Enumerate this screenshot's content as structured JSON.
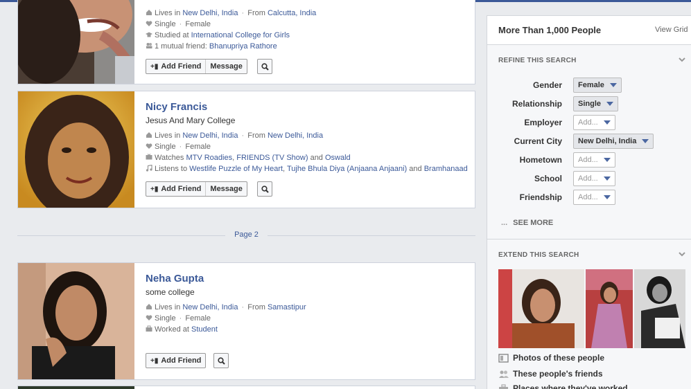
{
  "results": [
    {
      "name": "",
      "subtitle": "",
      "lines": [
        {
          "icon": "home-icon",
          "parts": [
            {
              "t": "Lives in "
            },
            {
              "t": "New Delhi, India",
              "link": true
            },
            {
              "t": " · ",
              "dot": true
            },
            {
              "t": "From "
            },
            {
              "t": "Calcutta, India",
              "link": true
            }
          ]
        },
        {
          "icon": "heart-icon",
          "parts": [
            {
              "t": "Single"
            },
            {
              "t": " · ",
              "dot": true
            },
            {
              "t": "Female"
            }
          ]
        },
        {
          "icon": "education-icon",
          "parts": [
            {
              "t": "Studied at "
            },
            {
              "t": "International College for Girls",
              "link": true
            }
          ]
        },
        {
          "icon": "mutual-friends-icon",
          "parts": [
            {
              "t": "1 mutual friend: "
            },
            {
              "t": "Bhanupriya Rathore",
              "link": true
            }
          ]
        }
      ],
      "buttons": [
        "Add Friend",
        "Message"
      ]
    },
    {
      "name": "Nicy Francis",
      "subtitle": "Jesus And Mary College",
      "lines": [
        {
          "icon": "home-icon",
          "parts": [
            {
              "t": "Lives in "
            },
            {
              "t": "New Delhi, India",
              "link": true
            },
            {
              "t": " · ",
              "dot": true
            },
            {
              "t": "From "
            },
            {
              "t": "New Delhi, India",
              "link": true
            }
          ]
        },
        {
          "icon": "heart-icon",
          "parts": [
            {
              "t": "Single"
            },
            {
              "t": " · ",
              "dot": true
            },
            {
              "t": "Female"
            }
          ]
        },
        {
          "icon": "tv-icon",
          "parts": [
            {
              "t": "Watches "
            },
            {
              "t": "MTV Roadies",
              "link": true
            },
            {
              "t": ", "
            },
            {
              "t": "FRIENDS (TV Show)",
              "link": true
            },
            {
              "t": " and "
            },
            {
              "t": "Oswald",
              "link": true
            }
          ]
        },
        {
          "icon": "music-icon",
          "parts": [
            {
              "t": "Listens to "
            },
            {
              "t": "Westlife",
              "link": true
            },
            {
              "t": " "
            },
            {
              "t": "Puzzle of My Heart",
              "link": true
            },
            {
              "t": ", "
            },
            {
              "t": "Tujhe Bhula Diya (Anjaana Anjaani)",
              "link": true
            },
            {
              "t": " and "
            },
            {
              "t": "Bramhanaad",
              "link": true
            }
          ]
        }
      ],
      "buttons": [
        "Add Friend",
        "Message"
      ]
    },
    {
      "name": "Neha Gupta",
      "subtitle": "some college",
      "lines": [
        {
          "icon": "home-icon",
          "parts": [
            {
              "t": "Lives in "
            },
            {
              "t": "New Delhi, India",
              "link": true
            },
            {
              "t": " · ",
              "dot": true
            },
            {
              "t": "From "
            },
            {
              "t": "Samastipur",
              "link": true
            }
          ]
        },
        {
          "icon": "heart-icon",
          "parts": [
            {
              "t": "Single"
            },
            {
              "t": " · ",
              "dot": true
            },
            {
              "t": "Female"
            }
          ]
        },
        {
          "icon": "work-icon",
          "parts": [
            {
              "t": "Worked at "
            },
            {
              "t": "Student",
              "link": true
            }
          ]
        }
      ],
      "buttons": [
        "Add Friend"
      ]
    }
  ],
  "pager": {
    "label": "Page 2"
  },
  "panel": {
    "title": "More Than 1,000 People",
    "view_grid": "View Grid",
    "refine_title": "REFINE THIS SEARCH",
    "filters": [
      {
        "label": "Gender",
        "value": "Female",
        "set": true
      },
      {
        "label": "Relationship",
        "value": "Single",
        "set": true
      },
      {
        "label": "Employer",
        "value": "Add...",
        "set": false
      },
      {
        "label": "Current City",
        "value": "New Delhi, India",
        "set": true
      },
      {
        "label": "Hometown",
        "value": "Add...",
        "set": false
      },
      {
        "label": "School",
        "value": "Add...",
        "set": false
      },
      {
        "label": "Friendship",
        "value": "Add...",
        "set": false
      }
    ],
    "see_more": "SEE MORE",
    "extend_title": "EXTEND THIS SEARCH",
    "extend_links": [
      {
        "label": "Photos of these people",
        "icon": "photos-icon"
      },
      {
        "label": "These people's friends",
        "icon": "friends-icon"
      },
      {
        "label": "Places where they've worked",
        "icon": "briefcase-icon"
      }
    ]
  },
  "colors": {
    "link": "#3b5998",
    "page_bg": "#e9ebee",
    "brand": "#3b5998"
  }
}
